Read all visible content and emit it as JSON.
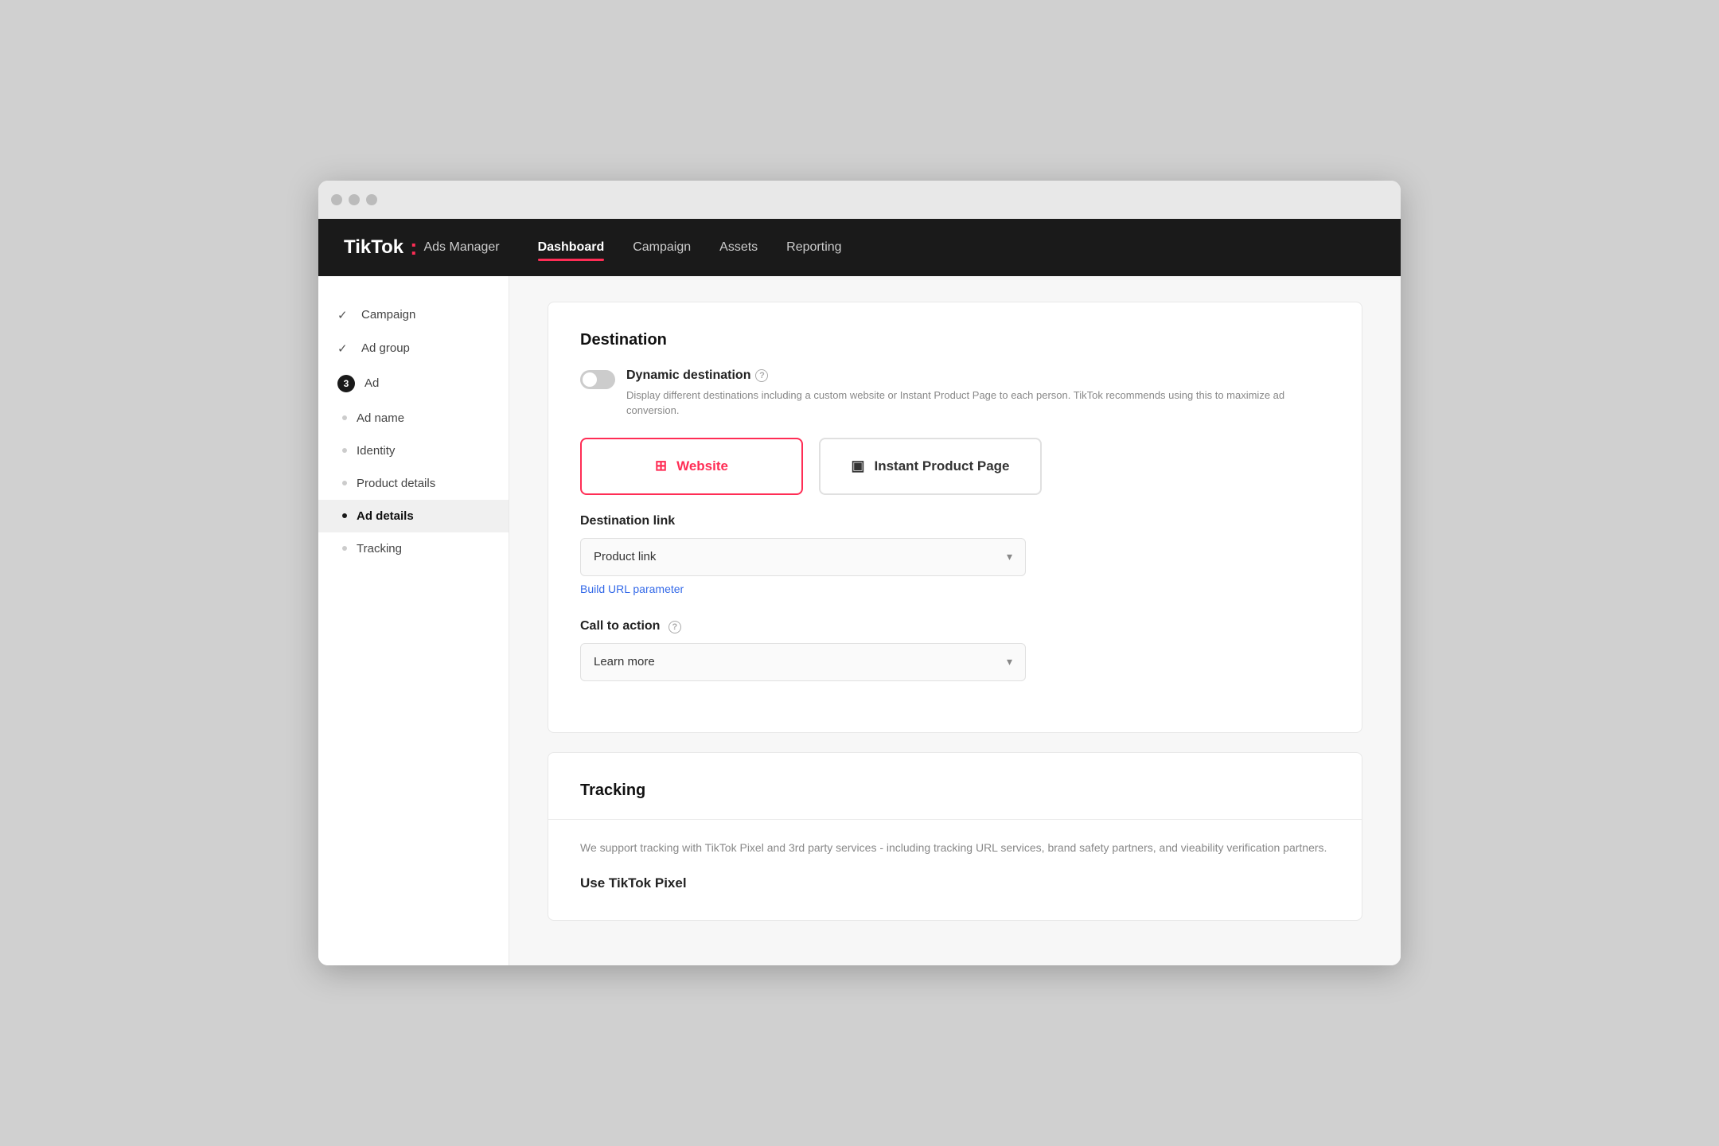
{
  "window": {
    "title": "TikTok Ads Manager"
  },
  "brand": {
    "tiktok": "TikTok",
    "dot": ":",
    "sub": "Ads Manager"
  },
  "topnav": {
    "items": [
      {
        "label": "Dashboard",
        "active": true
      },
      {
        "label": "Campaign",
        "active": false
      },
      {
        "label": "Assets",
        "active": false
      },
      {
        "label": "Reporting",
        "active": false
      }
    ]
  },
  "sidebar": {
    "items": [
      {
        "type": "check",
        "label": "Campaign",
        "active": false
      },
      {
        "type": "check",
        "label": "Ad group",
        "active": false
      },
      {
        "type": "number",
        "number": "3",
        "label": "Ad",
        "active": false
      },
      {
        "type": "bullet",
        "label": "Ad name",
        "active": false
      },
      {
        "type": "bullet",
        "label": "Identity",
        "active": false
      },
      {
        "type": "bullet",
        "label": "Product details",
        "active": false
      },
      {
        "type": "bullet-active",
        "label": "Ad details",
        "active": true
      },
      {
        "type": "bullet",
        "label": "Tracking",
        "active": false
      }
    ]
  },
  "destination": {
    "section_title": "Destination",
    "dynamic_dest_label": "Dynamic destination",
    "dynamic_dest_desc": "Display different destinations including a custom website or Instant Product Page to each person. TikTok recommends using this to maximize ad conversion.",
    "toggle_on": false,
    "help_tooltip": "Help",
    "dest_types": [
      {
        "label": "Website",
        "icon": "⊞",
        "selected": true
      },
      {
        "label": "Instant Product Page",
        "icon": "▣",
        "selected": false
      }
    ],
    "dest_link_label": "Destination link",
    "dest_link_value": "Product link",
    "build_url_label": "Build URL parameter",
    "call_to_action_label": "Call to action",
    "call_to_action_help": "Help",
    "call_to_action_value": "Learn more"
  },
  "tracking": {
    "section_title": "Tracking",
    "desc": "We support tracking with TikTok Pixel and 3rd party services - including tracking URL services, brand safety partners, and vieability verification partners.",
    "use_pixel_label": "Use TikTok Pixel"
  }
}
